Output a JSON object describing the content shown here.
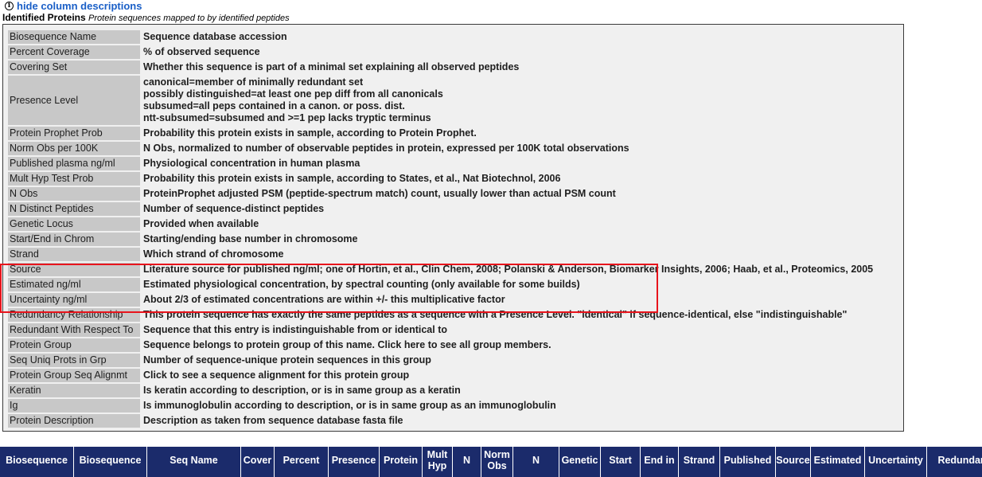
{
  "toggle": {
    "icon": "info-icon",
    "label": "hide column descriptions"
  },
  "section": {
    "title": "Identified Proteins",
    "subtitle": "Protein sequences mapped to by identified peptides"
  },
  "descriptions": [
    {
      "term": "Biosequence Name",
      "lines": [
        "Sequence database accession"
      ]
    },
    {
      "term": "Percent Coverage",
      "lines": [
        "% of observed sequence"
      ]
    },
    {
      "term": "Covering Set",
      "lines": [
        "Whether this sequence is part of a minimal set explaining all observed peptides"
      ]
    },
    {
      "term": "Presence Level",
      "lines": [
        "canonical=member of minimally redundant set",
        "possibly distinguished=at least one pep diff from all canonicals",
        "subsumed=all peps contained in a canon. or poss. dist.",
        "ntt-subsumed=subsumed and >=1 pep lacks tryptic terminus"
      ]
    },
    {
      "term": "Protein Prophet Prob",
      "lines": [
        "Probability this protein exists in sample, according to Protein Prophet."
      ]
    },
    {
      "term": "Norm Obs per 100K",
      "lines": [
        "N Obs, normalized to number of observable peptides in protein, expressed per 100K total observations"
      ]
    },
    {
      "term": "Published plasma ng/ml",
      "lines": [
        "Physiological concentration in human plasma"
      ]
    },
    {
      "term": "Mult Hyp Test Prob",
      "lines": [
        "Probability this protein exists in sample, according to States, et al., Nat Biotechnol, 2006"
      ]
    },
    {
      "term": "N Obs",
      "lines": [
        "ProteinProphet adjusted PSM (peptide-spectrum match) count, usually lower than actual PSM count"
      ]
    },
    {
      "term": "N Distinct Peptides",
      "lines": [
        "Number of sequence-distinct peptides"
      ]
    },
    {
      "term": "Genetic Locus",
      "lines": [
        "Provided when available"
      ]
    },
    {
      "term": "Start/End in Chrom",
      "lines": [
        "Starting/ending base number in chromosome"
      ]
    },
    {
      "term": "Strand",
      "lines": [
        "Which strand of chromosome"
      ]
    },
    {
      "term": "Source",
      "lines": [
        "Literature source for published ng/ml; one of Hortin, et al., Clin Chem, 2008; Polanski & Anderson, Biomarker Insights, 2006; Haab, et al., Proteomics, 2005"
      ]
    },
    {
      "term": "Estimated ng/ml",
      "lines": [
        "Estimated physiological concentration, by spectral counting (only available for some builds)"
      ]
    },
    {
      "term": "Uncertainty ng/ml",
      "lines": [
        "About 2/3 of estimated concentrations are within +/- this multiplicative factor"
      ]
    },
    {
      "term": "Redundancy Relationship",
      "lines": [
        "This protein sequence has exactly the same peptides as a sequence with a Presence Level. \"identical\" if sequence-identical, else \"indistinguishable\""
      ]
    },
    {
      "term": "Redundant With Respect To",
      "lines": [
        "Sequence that this entry is indistinguishable from or identical to"
      ]
    },
    {
      "term": "Protein Group",
      "lines": [
        "Sequence belongs to protein group of this name. Click here to see all group members."
      ]
    },
    {
      "term": "Seq Uniq Prots in Grp",
      "lines": [
        "Number of sequence-unique protein sequences in this group"
      ]
    },
    {
      "term": "Protein Group Seq Alignmt",
      "lines": [
        "Click to see a sequence alignment for this protein group"
      ]
    },
    {
      "term": "Keratin",
      "lines": [
        "Is keratin according to description, or is in same group as a keratin"
      ]
    },
    {
      "term": "Ig",
      "lines": [
        "Is immunoglobulin according to description, or is in same group as an immunoglobulin"
      ]
    },
    {
      "term": "Protein Description",
      "lines": [
        "Description as taken from sequence database fasta file"
      ]
    }
  ],
  "highlight": {
    "color": "#e8141c"
  },
  "table_headers": [
    "Biosequence",
    "Biosequence",
    "Seq Name",
    "Cover",
    "Percent",
    "Presence",
    "Protein",
    "Mult\nHyp",
    "N",
    "Norm\nObs",
    "N",
    "Genetic",
    "Start",
    "End in",
    "Strand",
    "Published",
    "Source",
    "Estimated",
    "Uncertainty",
    "Redundan"
  ],
  "colors": {
    "header_bg": "#1b2b6b",
    "link": "#1a5fc7",
    "term_bg": "#c8c8c8",
    "box_bg": "#f0f0f0"
  }
}
